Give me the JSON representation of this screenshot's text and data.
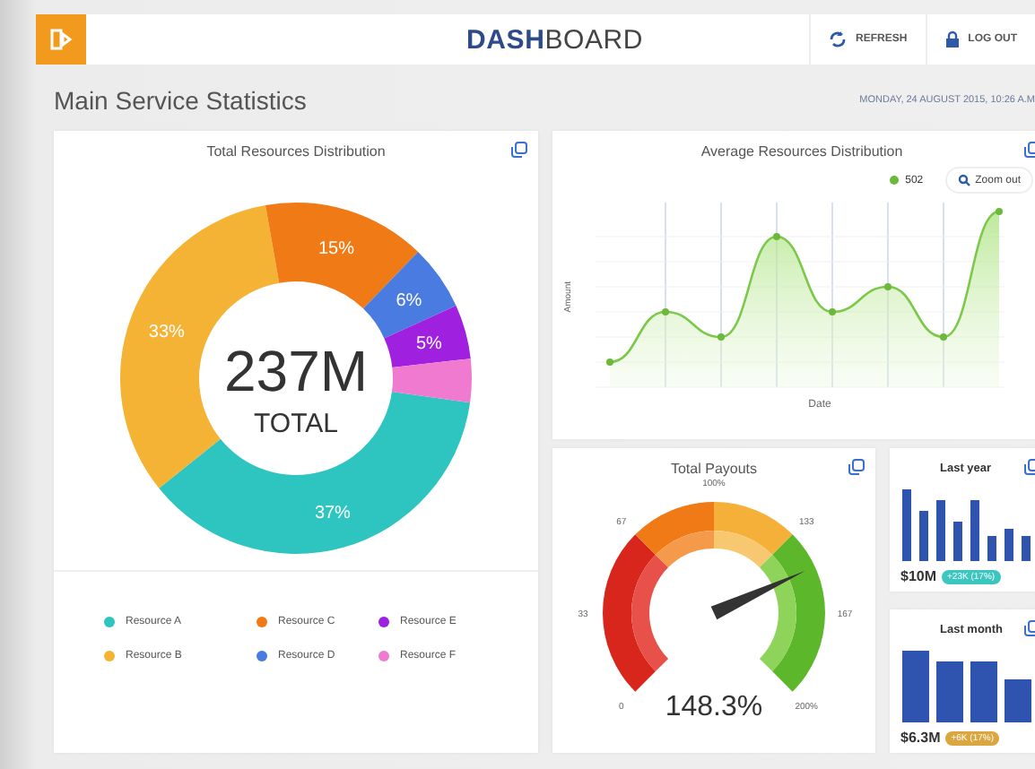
{
  "header": {
    "title": "**DASH**BOARD",
    "actions": [
      {
        "kind": "refresh",
        "label": "REFRESH"
      },
      {
        "kind": "logout",
        "label": "LOG OUT"
      }
    ]
  },
  "page": {
    "title": "Main Service Statistics",
    "date": "MONDAY, 24 AUGUST 2015, 10:26 A.M"
  },
  "resources_card": {
    "title": "Total Resources Distribution",
    "center_value": "237M",
    "center_label": "TOTAL",
    "chart_data": {
      "type": "donut",
      "values": [
        37,
        33,
        15,
        6,
        5,
        4
      ],
      "value_labels": [
        "37%",
        "33%",
        "15%",
        "6%",
        "5%",
        null
      ]
    },
    "legend": [
      {
        "label": "Resource A",
        "color": "#2ec4c0"
      },
      {
        "label": "Resource B",
        "color": "#f5b335"
      },
      {
        "label": "Resource C",
        "color": "#f07a16"
      },
      {
        "label": "Resource D",
        "color": "#4a7be0"
      },
      {
        "label": "Resource E",
        "color": "#a020e0"
      },
      {
        "label": "Resource F",
        "color": "#f07ad0"
      }
    ]
  },
  "average_card": {
    "title": "Average Resources Distribution",
    "series_label": "502",
    "zoom_button": "Zoom out",
    "ylabel": "Amount",
    "xlabel": "Date"
  },
  "payouts_card": {
    "title": "Total Payouts",
    "ticks": [
      "0",
      "33",
      "67",
      "100%",
      "133",
      "167",
      "200%"
    ],
    "level": 0.7415,
    "reading": "148.3%"
  },
  "mini_cards": [
    {
      "kind": "thin",
      "title": "Last year",
      "amount": "$10M",
      "badge": "+23K (17%)",
      "color": "#3cc6c0"
    },
    {
      "kind": "wide",
      "title": "Last month",
      "amount": "$6.3M",
      "badge": "+6K (17%)",
      "color": "#d9a640"
    }
  ]
}
